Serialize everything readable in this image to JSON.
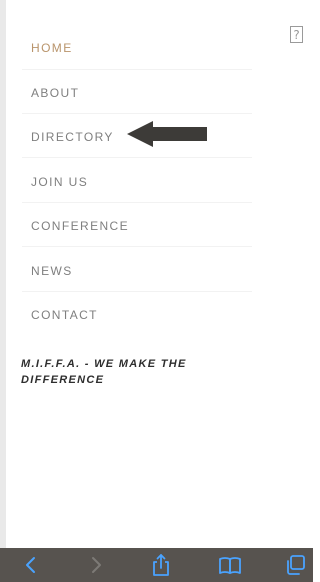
{
  "menu": {
    "items": [
      {
        "label": "HOME",
        "active": true
      },
      {
        "label": "ABOUT",
        "active": false
      },
      {
        "label": "DIRECTORY",
        "active": false
      },
      {
        "label": "JOIN US",
        "active": false
      },
      {
        "label": "CONFERENCE",
        "active": false
      },
      {
        "label": "NEWS",
        "active": false
      },
      {
        "label": "CONTACT",
        "active": false
      }
    ]
  },
  "tagline": "M.I.F.F.A. - WE MAKE THE DIFFERENCE",
  "help_icon_glyph": "?",
  "colors": {
    "active": "#b9946b",
    "menu_text": "#7f7f7f",
    "toolbar_bg": "#57534f",
    "toolbar_icon": "#4aa3ff",
    "arrow": "#3d3b38"
  },
  "toolbar": {
    "icons": [
      "back-icon",
      "forward-icon",
      "share-icon",
      "bookmarks-icon",
      "tabs-icon"
    ]
  }
}
